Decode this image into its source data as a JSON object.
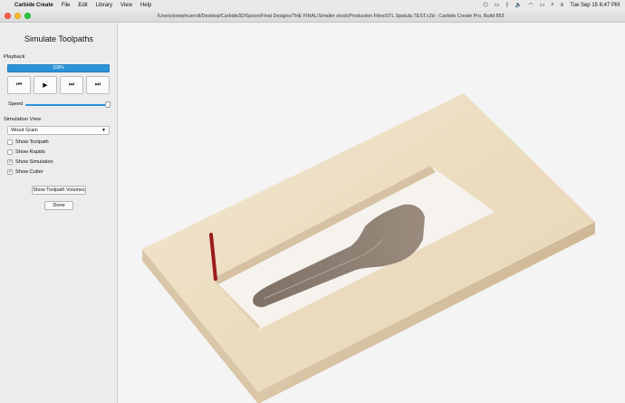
{
  "menubar": {
    "app_name": "Carbide Create",
    "items": [
      "File",
      "Edit",
      "Library",
      "View",
      "Help"
    ],
    "clock": "Tue Sep 15  6:47 PM"
  },
  "window": {
    "title": "/Users/josephcarroll/Desktop/Carbide3D/Spoon/Final Designs/THE FINAL/Smaller stock/Production Files/STL Spatula TEST.c2d - Carbide Create Pro, Build 853"
  },
  "panel": {
    "title": "Simulate Toolpaths",
    "playback_label": "Playback",
    "progress_text": "100%",
    "progress_value": 100,
    "controls": [
      "⏮",
      "▶",
      "⏭",
      "⏭"
    ],
    "speed_label": "Speed",
    "speed_value": 0.96,
    "sim_view_label": "Simulation View",
    "material": "Wood Grain",
    "options": [
      {
        "label": "Show Toolpath",
        "checked": false
      },
      {
        "label": "Show Rapids",
        "checked": false
      },
      {
        "label": "Show Simulation",
        "checked": true
      },
      {
        "label": "Show Cutter",
        "checked": true
      }
    ],
    "volumes_button": "Show Toolpath Volumes",
    "done_button": "Done"
  },
  "colors": {
    "accent": "#2a93d5",
    "stock_top": "#efe2c8",
    "stock_side": "#d8c3a5",
    "part": "#8e7f73",
    "cutter": "#9b1c1c"
  }
}
